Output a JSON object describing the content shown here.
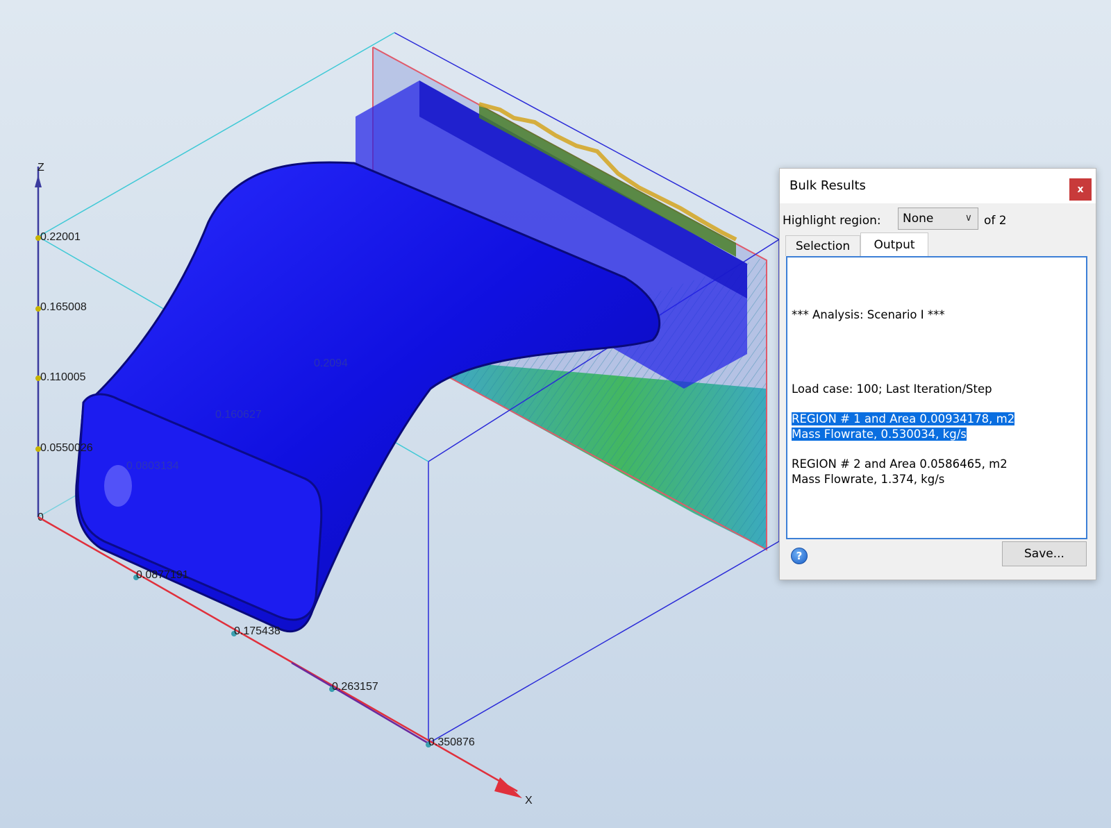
{
  "viewport": {
    "axes": {
      "z_label": "Z",
      "x_label": "X",
      "z_ticks": [
        "0.22001",
        "0.165008",
        "0.110005",
        "0.0550026",
        "0"
      ],
      "x_ticks": [
        "0.0877191",
        "0.175438",
        "0.263157",
        "0.350876"
      ],
      "ghost_ticks": [
        "0.0803134",
        "0.160627",
        "0.2094"
      ]
    },
    "colors": {
      "duct": "#1414e6",
      "z_axis": "#3b3b9e",
      "x_axis": "#e0303c",
      "bbox": "#2a2ad8",
      "flow_green": "#2fb54a",
      "flow_cyan": "#27a6b8"
    }
  },
  "dialog": {
    "title": "Bulk Results",
    "close_label": "x",
    "highlight_label": "Highlight region:",
    "region_value": "None",
    "of_label": "of 2",
    "tabs": [
      "Selection",
      "Output"
    ],
    "active_tab": "Output",
    "output": {
      "analysis": "*** Analysis: Scenario I ***",
      "load_case": "Load case: 100; Last Iteration/Step",
      "region1_line1": "REGION # 1 and Area 0.00934178, m2",
      "region1_line2": "Mass Flowrate, 0.530034, kg/s",
      "region2_line1": "REGION # 2 and Area 0.0586465, m2",
      "region2_line2": "Mass Flowrate, 1.374, kg/s"
    },
    "help_label": "?",
    "save_label": "Save..."
  }
}
